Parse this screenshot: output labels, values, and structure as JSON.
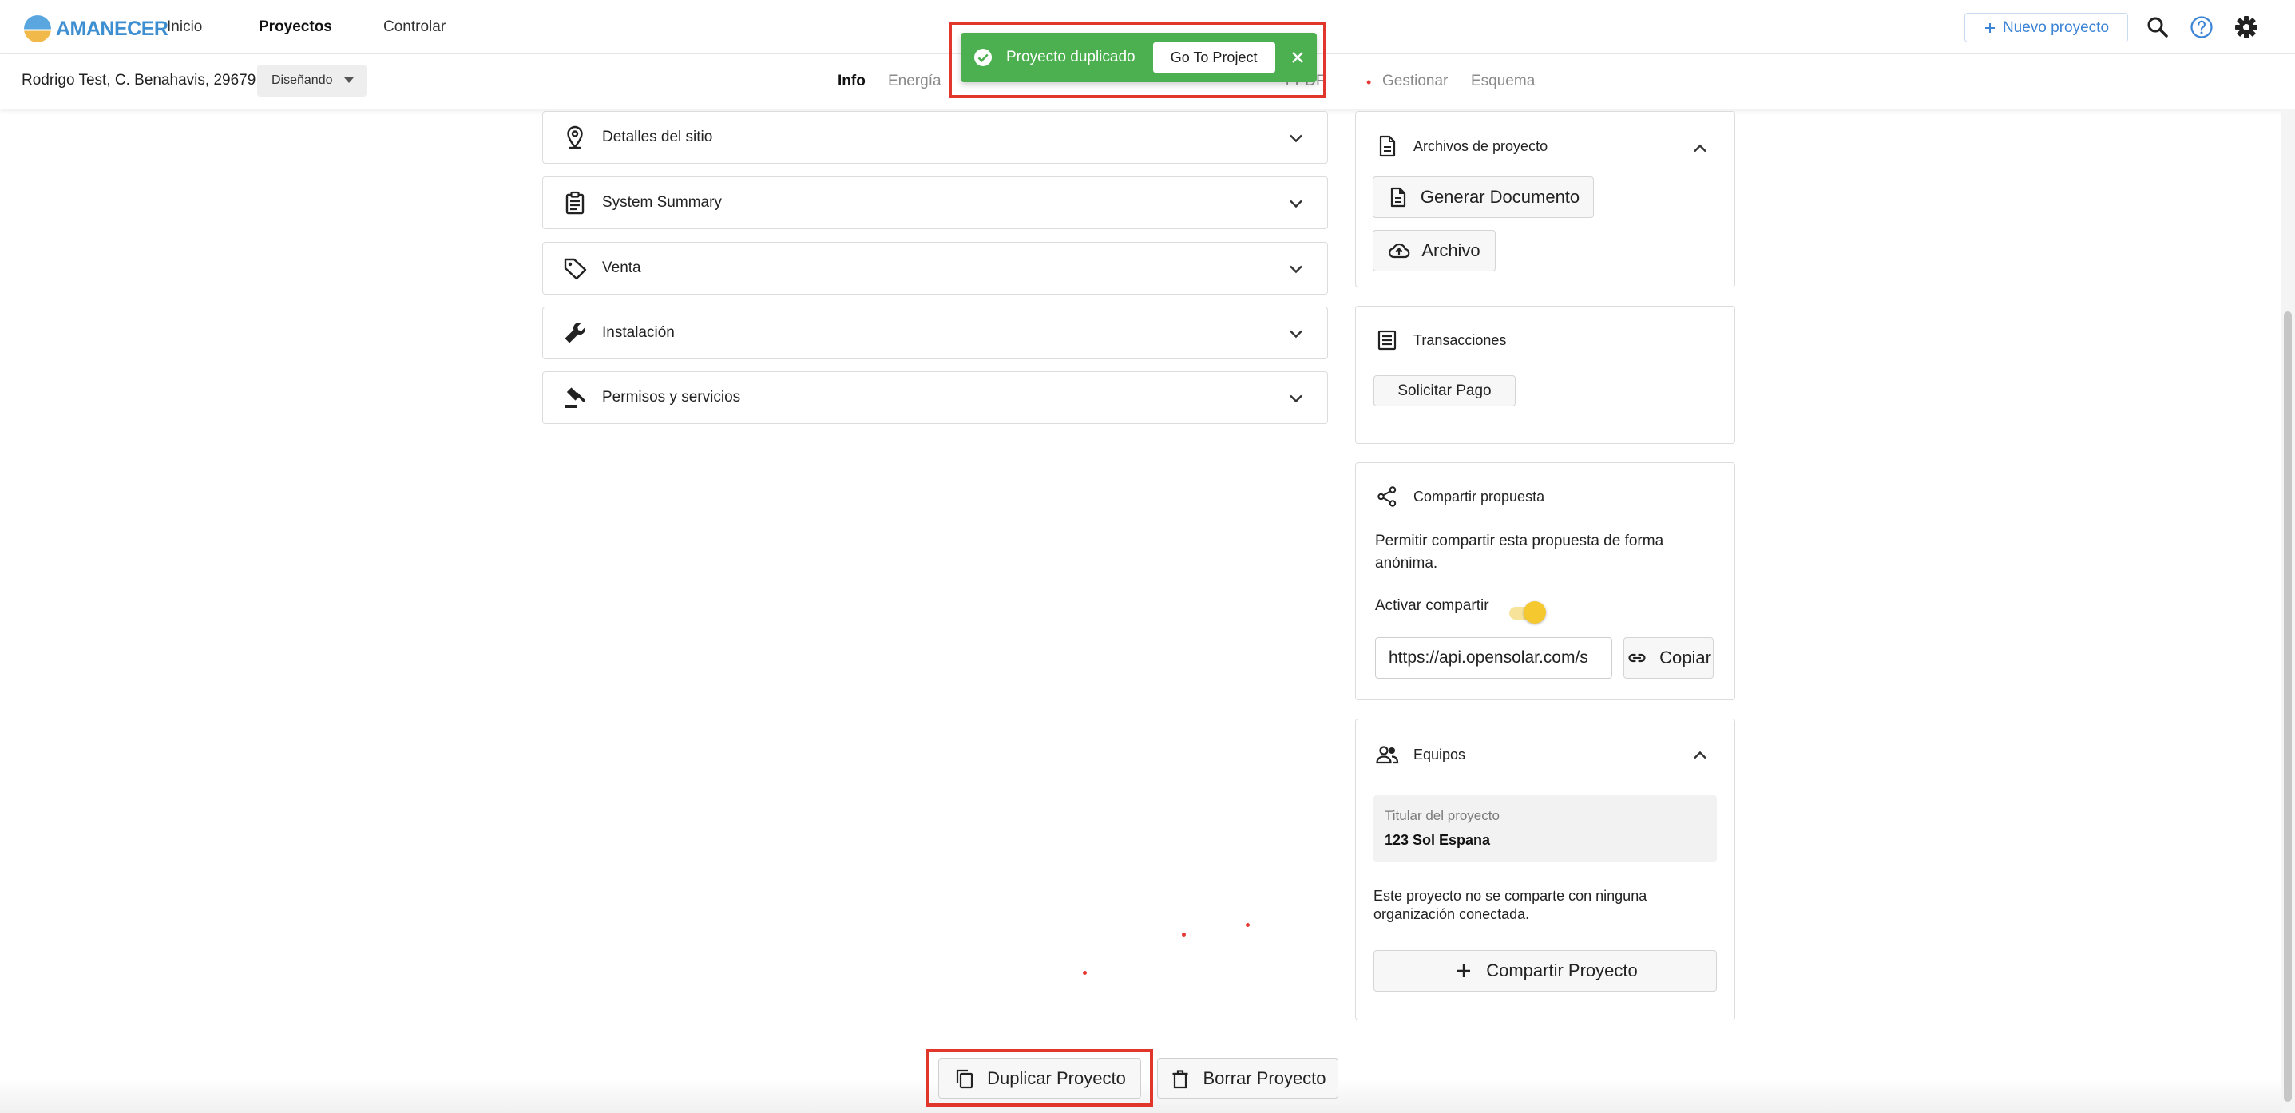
{
  "brand": {
    "name": "AMANECER"
  },
  "nav": {
    "items": [
      {
        "label": "Inicio"
      },
      {
        "label": "Proyectos"
      },
      {
        "label": "Controlar"
      }
    ],
    "new_project_label": "Nuevo proyecto"
  },
  "project": {
    "address": "Rodrigo Test, C. Benahavis, 29679",
    "status": "Diseñando"
  },
  "tabs": [
    {
      "label": "Info"
    },
    {
      "label": "Energía"
    },
    {
      "label": "r PDF"
    },
    {
      "label": "Gestionar"
    },
    {
      "label": "Esquema"
    }
  ],
  "toast": {
    "message": "Proyecto duplicado",
    "action_label": "Go To Project"
  },
  "sections": [
    {
      "label": "Detalles del sitio",
      "icon": "location-pin-icon"
    },
    {
      "label": "System Summary",
      "icon": "clipboard-icon"
    },
    {
      "label": "Venta",
      "icon": "tag-icon"
    },
    {
      "label": "Instalación",
      "icon": "wrench-icon"
    },
    {
      "label": "Permisos y servicios",
      "icon": "gavel-icon"
    }
  ],
  "files_card": {
    "title": "Archivos de proyecto",
    "generate_label": "Generar Documento",
    "upload_label": "Archivo"
  },
  "transactions_card": {
    "title": "Transacciones",
    "request_payment_label": "Solicitar Pago"
  },
  "share_card": {
    "title": "Compartir propuesta",
    "description_line1": "Permitir compartir esta propuesta de forma",
    "description_line2": "anónima.",
    "toggle_label": "Activar compartir",
    "toggle_on": true,
    "url": "https://api.opensolar.com/s",
    "copy_label": "Copiar"
  },
  "teams_card": {
    "title": "Equipos",
    "owner_label": "Titular del proyecto",
    "owner_name": "123 Sol Espana",
    "note_line1": "Este proyecto no se comparte con ninguna",
    "note_line2": "organización conectada.",
    "share_label": "Compartir Proyecto"
  },
  "actions": {
    "duplicate_label": "Duplicar Proyecto",
    "delete_label": "Borrar Proyecto"
  },
  "colors": {
    "brand_blue": "#3d8fd1",
    "toast_green": "#4caf50",
    "highlight_red": "#e0362c",
    "toggle_yellow": "#f5c830"
  }
}
